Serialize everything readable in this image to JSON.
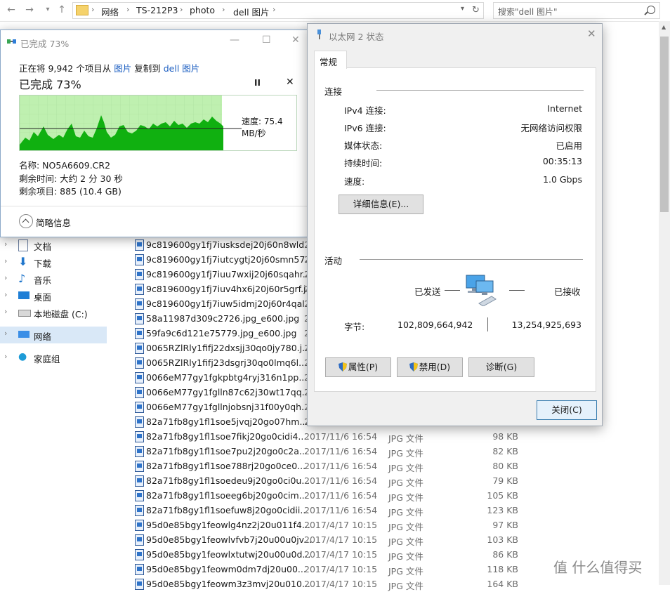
{
  "explorer": {
    "breadcrumb": [
      "网络",
      "TS-212P3",
      "photo",
      "dell 图片"
    ],
    "search_placeholder": "搜索\"dell 图片\"",
    "nav": [
      {
        "label": "文档",
        "icon": "document-icon"
      },
      {
        "label": "下载",
        "icon": "download-icon"
      },
      {
        "label": "音乐",
        "icon": "music-icon"
      },
      {
        "label": "桌面",
        "icon": "desktop-icon"
      },
      {
        "label": "本地磁盘 (C:)",
        "icon": "drive-icon"
      },
      {
        "label": "网络",
        "icon": "network-icon"
      },
      {
        "label": "家庭组",
        "icon": "homegroup-icon"
      }
    ],
    "files": [
      {
        "name": "9c819600gy1fj7iusksdej20j60n8wld...",
        "date": "2...",
        "type": "",
        "size": ""
      },
      {
        "name": "9c819600gy1fj7iutcygtj20j60smn57...",
        "date": "2...",
        "type": "",
        "size": ""
      },
      {
        "name": "9c819600gy1fj7iuu7wxij20j60sqahr...",
        "date": "2...",
        "type": "",
        "size": ""
      },
      {
        "name": "9c819600gy1fj7iuv4hx6j20j60r5grf.j...",
        "date": "2...",
        "type": "",
        "size": ""
      },
      {
        "name": "9c819600gy1fj7iuw5idmj20j60r4qal...",
        "date": "2...",
        "type": "",
        "size": ""
      },
      {
        "name": "58a11987d309c2726.jpg_e600.jpg",
        "date": "2...",
        "type": "",
        "size": ""
      },
      {
        "name": "59fa9c6d121e75779.jpg_e600.jpg",
        "date": "2...",
        "type": "",
        "size": ""
      },
      {
        "name": "0065RZlRly1fifj22dxsjj30qo0jy780.j...",
        "date": "2...",
        "type": "",
        "size": ""
      },
      {
        "name": "0065RZlRly1fifj23dsgrj30qo0lmq6l....",
        "date": "2...",
        "type": "",
        "size": ""
      },
      {
        "name": "0066eM77gy1fgkpbtg4ryj316n1pp...",
        "date": "2...",
        "type": "",
        "size": ""
      },
      {
        "name": "0066eM77gy1fglln87c62j30wt17qq...",
        "date": "2...",
        "type": "",
        "size": ""
      },
      {
        "name": "0066eM77gy1fgllnjobsnj31f00y0qh...",
        "date": "2...",
        "type": "",
        "size": ""
      },
      {
        "name": "82a71fb8gy1fl1soe5jvqj20go07hm...",
        "date": "2...",
        "type": "",
        "size": ""
      },
      {
        "name": "82a71fb8gy1fl1soe7fikj20go0cidi4....",
        "date": "2017/11/6 16:54",
        "type": "JPG 文件",
        "size": "98 KB"
      },
      {
        "name": "82a71fb8gy1fl1soe7pu2j20go0c2a...",
        "date": "2017/11/6 16:54",
        "type": "JPG 文件",
        "size": "82 KB"
      },
      {
        "name": "82a71fb8gy1fl1soe788rj20go0ce0...",
        "date": "2017/11/6 16:54",
        "type": "JPG 文件",
        "size": "80 KB"
      },
      {
        "name": "82a71fb8gy1fl1soedeu9j20go0ci0u...",
        "date": "2017/11/6 16:54",
        "type": "JPG 文件",
        "size": "79 KB"
      },
      {
        "name": "82a71fb8gy1fl1soeeg6bj20go0cim...",
        "date": "2017/11/6 16:54",
        "type": "JPG 文件",
        "size": "105 KB"
      },
      {
        "name": "82a71fb8gy1fl1soefuw8j20go0cidii...",
        "date": "2017/11/6 16:54",
        "type": "JPG 文件",
        "size": "123 KB"
      },
      {
        "name": "95d0e85bgy1feowlg4nz2j20u011f4...",
        "date": "2017/4/17 10:15",
        "type": "JPG 文件",
        "size": "97 KB"
      },
      {
        "name": "95d0e85bgy1feowlvfvb7j20u00u0jv...",
        "date": "2017/4/17 10:15",
        "type": "JPG 文件",
        "size": "103 KB"
      },
      {
        "name": "95d0e85bgy1feowlxtutwj20u00u0d...",
        "date": "2017/4/17 10:15",
        "type": "JPG 文件",
        "size": "86 KB"
      },
      {
        "name": "95d0e85bgy1feowm0dm7dj20u00...",
        "date": "2017/4/17 10:15",
        "type": "JPG 文件",
        "size": "118 KB"
      },
      {
        "name": "95d0e85bgy1feowm3z3mvj20u010...",
        "date": "2017/4/17 10:15",
        "type": "JPG 文件",
        "size": "164 KB"
      }
    ]
  },
  "copy_dialog": {
    "title": "已完成 73%",
    "line_prefix": "正在将 9,942 个项目从",
    "from": "图片",
    "mid": "复制到",
    "to": "dell 图片",
    "percent_text": "已完成 73%",
    "progress": 0.73,
    "speed": "速度: 75.4 MB/秒",
    "name": "名称: NO5A6609.CR2",
    "time_left": "剩余时间: 大约 2 分 30 秒",
    "items_left": "剩余项目: 885 (10.4 GB)",
    "details_toggle": "简略信息",
    "pause_glyph": "II",
    "cancel_glyph": "✕"
  },
  "eth_dialog": {
    "title": "以太网 2 状态",
    "tab": "常规",
    "connection_group": "连接",
    "rows": [
      {
        "k": "IPv4 连接:",
        "v": "Internet"
      },
      {
        "k": "IPv6 连接:",
        "v": "无网络访问权限"
      },
      {
        "k": "媒体状态:",
        "v": "已启用"
      },
      {
        "k": "持续时间:",
        "v": "00:35:13"
      },
      {
        "k": "速度:",
        "v": "1.0 Gbps"
      }
    ],
    "details_btn": "详细信息(E)...",
    "activity_group": "活动",
    "sent_label": "已发送",
    "recv_label": "已接收",
    "bytes_label": "字节:",
    "bytes_sent": "102,809,664,942",
    "bytes_recv": "13,254,925,693",
    "properties_btn": "属性(P)",
    "disable_btn": "禁用(D)",
    "diagnose_btn": "诊断(G)",
    "close_btn": "关闭(C)"
  },
  "watermark": "值 什么值得买",
  "colors": {
    "graph_fill": "#10b010",
    "graph_bg": "#bff0b0",
    "link": "#1d5fc2"
  }
}
